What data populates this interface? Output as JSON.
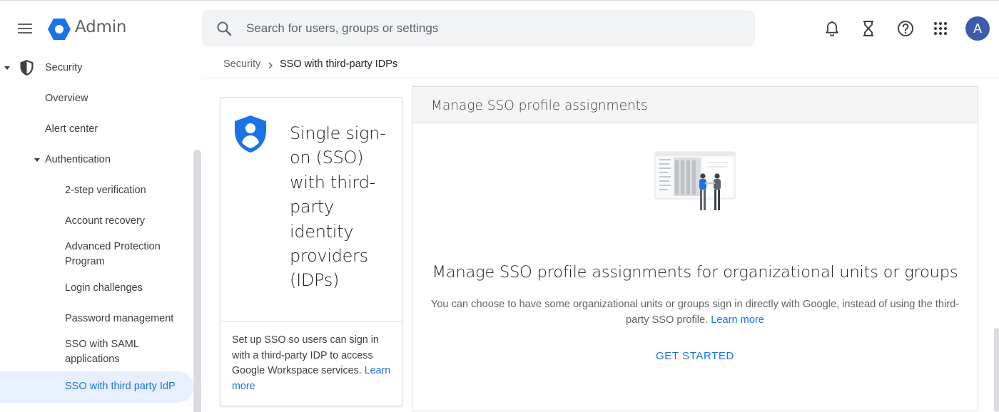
{
  "header": {
    "product_name": "Admin",
    "search_placeholder": "Search for users, groups or settings",
    "avatar_initial": "A",
    "icons": [
      "menu-icon",
      "admin-logo",
      "search-icon",
      "notifications-icon",
      "tasks-icon",
      "help-icon",
      "apps-icon"
    ]
  },
  "sidebar": {
    "section": "Security",
    "items": [
      {
        "label": "Overview"
      },
      {
        "label": "Alert center"
      },
      {
        "label": "Authentication"
      },
      {
        "label": "2-step verification"
      },
      {
        "label": "Account recovery"
      },
      {
        "label": "Advanced Protection Program"
      },
      {
        "label": "Login challenges"
      },
      {
        "label": "Password management"
      },
      {
        "label": "SSO with SAML applications"
      },
      {
        "label": "SSO with third party IdP",
        "active": true
      }
    ]
  },
  "breadcrumb": {
    "parent": "Security",
    "current": "SSO with third-party IDPs"
  },
  "info_card": {
    "title": "Single sign-on (SSO) with third-party identity providers (IDPs)",
    "description": "Set up SSO so users can sign in with a third-party IDP to access Google Workspace services.",
    "link": "Learn more"
  },
  "panel": {
    "header": "Manage SSO profile assignments",
    "heading": "Manage SSO profile assignments for organizational units or groups",
    "description": "You can choose to have some organizational units or groups sign in directly with Google, instead of using the third-party SSO profile.",
    "link": "Learn more",
    "cta": "GET STARTED"
  },
  "colors": {
    "accent": "#1a73e8",
    "active_bg": "#e8f0fe",
    "avatar": "#3c5ba9",
    "search_bg": "#f1f3f4"
  }
}
